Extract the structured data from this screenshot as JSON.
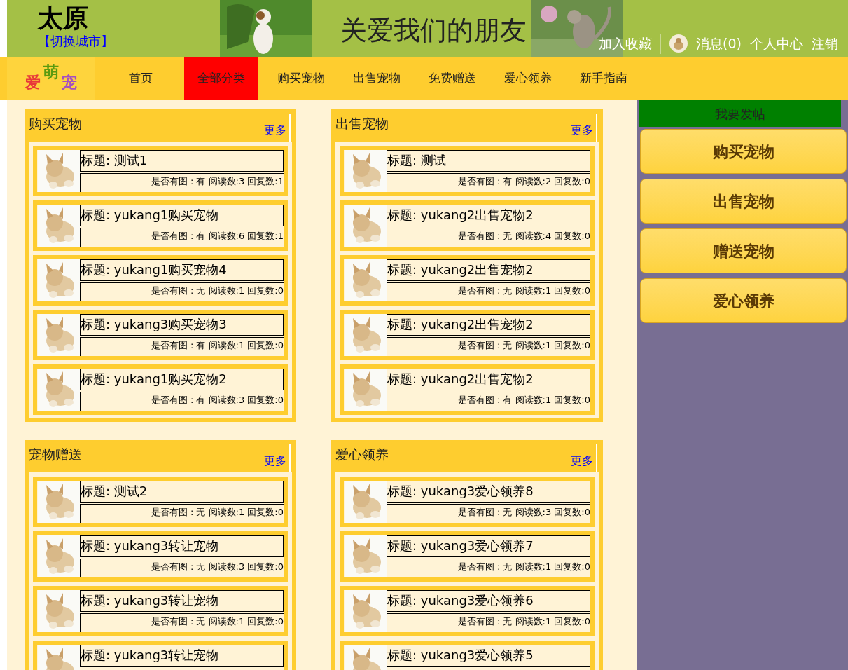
{
  "header": {
    "city": "太原",
    "switch_city": "【切换城市】",
    "banner_slogan": "关爱我们的朋友",
    "links": [
      {
        "kind": "link",
        "label": "加入收藏"
      },
      {
        "kind": "avatar"
      },
      {
        "kind": "link",
        "label": "消息(0)"
      },
      {
        "kind": "link",
        "label": "个人中心"
      },
      {
        "kind": "link",
        "label": "注销"
      }
    ]
  },
  "logo": [
    {
      "char": "爱",
      "color": "#e8393a"
    },
    {
      "char": "萌",
      "color": "#5a9a10"
    },
    {
      "char": "宠",
      "color": "#a64fc0"
    }
  ],
  "nav": [
    {
      "label": "首页",
      "selected": false
    },
    {
      "label": "全部分类",
      "selected": true
    },
    {
      "label": "购买宠物",
      "selected": false
    },
    {
      "label": "出售宠物",
      "selected": false
    },
    {
      "label": "免费赠送",
      "selected": false
    },
    {
      "label": "爱心领养",
      "selected": false
    },
    {
      "label": "新手指南",
      "selected": false
    }
  ],
  "sections": [
    {
      "title": "购买宠物",
      "more": "更多",
      "posts": [
        {
          "title": "标题: 测试1",
          "info": "是否有图 : 有 阅读数:3 回复数:1"
        },
        {
          "title": "标题: yukang1购买宠物",
          "info": "是否有图 : 有 阅读数:6 回复数:1"
        },
        {
          "title": "标题: yukang1购买宠物4",
          "info": "是否有图 : 无 阅读数:1 回复数:0"
        },
        {
          "title": "标题: yukang3购买宠物3",
          "info": "是否有图 : 有 阅读数:1 回复数:0"
        },
        {
          "title": "标题: yukang1购买宠物2",
          "info": "是否有图 : 有 阅读数:3 回复数:0"
        }
      ]
    },
    {
      "title": "出售宠物",
      "more": "更多",
      "posts": [
        {
          "title": "标题: 测试",
          "info": "是否有图 : 有 阅读数:2 回复数:0"
        },
        {
          "title": "标题: yukang2出售宠物2",
          "info": "是否有图 : 无 阅读数:4 回复数:0"
        },
        {
          "title": "标题: yukang2出售宠物2",
          "info": "是否有图 : 无 阅读数:1 回复数:0"
        },
        {
          "title": "标题: yukang2出售宠物2",
          "info": "是否有图 : 无 阅读数:1 回复数:0"
        },
        {
          "title": "标题: yukang2出售宠物2",
          "info": "是否有图 : 有 阅读数:1 回复数:0"
        }
      ]
    },
    {
      "title": "宠物赠送",
      "more": "更多",
      "posts": [
        {
          "title": "标题: 测试2",
          "info": "是否有图 : 无 阅读数:1 回复数:0"
        },
        {
          "title": "标题: yukang3转让宠物",
          "info": "是否有图 : 无 阅读数:3 回复数:0"
        },
        {
          "title": "标题: yukang3转让宠物",
          "info": "是否有图 : 无 阅读数:1 回复数:0"
        },
        {
          "title": "标题: yukang3转让宠物"
        }
      ]
    },
    {
      "title": "爱心领养",
      "more": "更多",
      "posts": [
        {
          "title": "标题: yukang3爱心领养8",
          "info": "是否有图 : 无 阅读数:3 回复数:0"
        },
        {
          "title": "标题: yukang3爱心领养7",
          "info": "是否有图 : 无 阅读数:1 回复数:0"
        },
        {
          "title": "标题: yukang3爱心领养6",
          "info": "是否有图 : 无 阅读数:1 回复数:0"
        },
        {
          "title": "标题: yukang3爱心领养5"
        }
      ]
    }
  ],
  "sidebar": {
    "post_button": "我要发帖",
    "categories": [
      "购买宠物",
      "出售宠物",
      "赠送宠物",
      "爱心领养"
    ]
  }
}
